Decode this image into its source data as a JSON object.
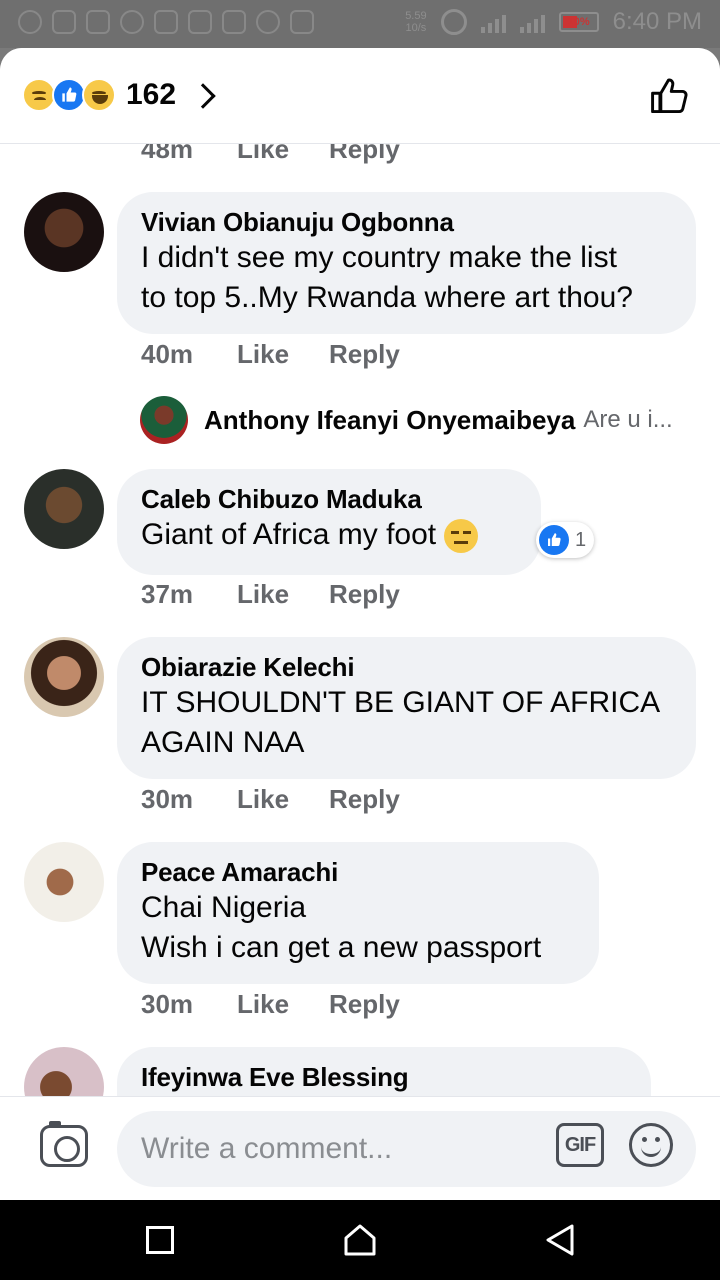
{
  "status_bar": {
    "speed_top": "5.59",
    "speed_bottom": "10/s",
    "battery": "10%",
    "time": "6:40 PM"
  },
  "header": {
    "reaction_icons": [
      "sad-emoji",
      "like-thumb",
      "haha-emoji"
    ],
    "reaction_count": "162"
  },
  "comments": [
    {
      "author": "Vivian Obianuju Ogbonna",
      "text_lines": [
        "I didn't see my country make the list",
        "to top 5..My Rwanda where art thou?"
      ],
      "time": "40m",
      "like": "Like",
      "reply": "Reply"
    },
    {
      "author": "Caleb Chibuzo Maduka",
      "text_lines": [
        "Giant of Africa my foot"
      ],
      "time": "37m",
      "like": "Like",
      "reply": "Reply",
      "reaction_count": "1"
    },
    {
      "author": "Obiarazie Kelechi",
      "text_lines": [
        "IT SHOULDN'T BE GIANT OF AFRICA",
        "AGAIN NAA"
      ],
      "time": "30m",
      "like": "Like",
      "reply": "Reply"
    },
    {
      "author": "Peace Amarachi",
      "text_lines": [
        "Chai Nigeria",
        "Wish i can get a new passport"
      ],
      "time": "30m",
      "like": "Like",
      "reply": "Reply"
    },
    {
      "author": "Ifeyinwa Eve Blessing",
      "text_lines": []
    }
  ],
  "previous_meta": {
    "time": "48m",
    "like": "Like",
    "reply": "Reply"
  },
  "reply_preview": {
    "author": "Anthony Ifeanyi Onyemaibeya",
    "snippet": "Are u i..."
  },
  "composer": {
    "placeholder": "Write a comment...",
    "gif_label": "GIF"
  },
  "colors": {
    "bubble": "#f0f2f5",
    "meta_text": "#65676b",
    "like_blue": "#1877f2"
  }
}
